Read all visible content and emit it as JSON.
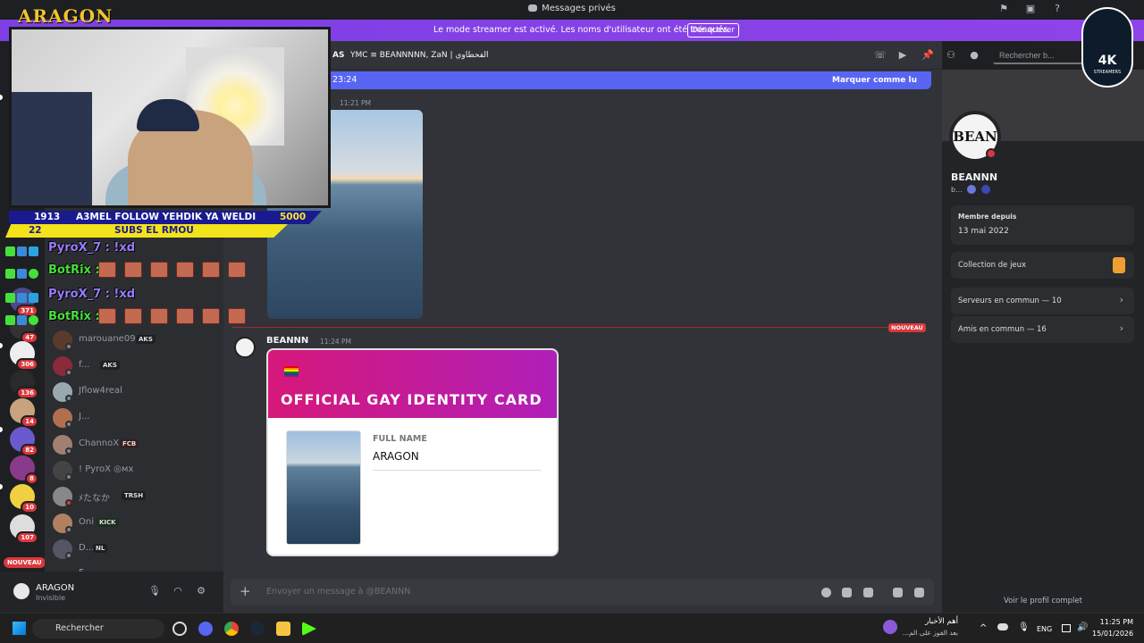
{
  "window": {
    "title": "Messages privés"
  },
  "streamer_banner": {
    "message": "Le mode streamer est activé. Les noms d'utilisateur ont été tronqués.",
    "button": "Désactiver"
  },
  "rail": {
    "badges": [
      "371",
      "47",
      "306",
      "136",
      "14",
      "82",
      "8",
      "10",
      "107"
    ],
    "nouveau": "NOUVEAU"
  },
  "dm_list": [
    {
      "name": "marouane09",
      "tag": "AKS"
    },
    {
      "name": "f...",
      "tag": "AKS"
    },
    {
      "name": "Jflow4real",
      "tag": ""
    },
    {
      "name": "J...",
      "tag": ""
    },
    {
      "name": "ChannoX",
      "tag": "FCB"
    },
    {
      "name": "! PyroX ◎мx",
      "tag": ""
    },
    {
      "name": "ﾒたなか",
      "tag": "TRSH"
    },
    {
      "name": "Oni",
      "tag": "KICK"
    },
    {
      "name": "D...",
      "tag": "NL"
    },
    {
      "name": "F",
      "tag": ""
    }
  ],
  "user_panel": {
    "name": "ARAGON",
    "status": "Invisible"
  },
  "header": {
    "group_names": "YMC ≡ BEANNNNN, ZaN | الفحطاوي",
    "prefix": "AS",
    "search_placeholder": "Rechercher b..."
  },
  "new_messages_bar": {
    "left": "23:24",
    "right": "Marquer comme lu"
  },
  "messages": {
    "photo_time": "11:21 PM",
    "new_label": "NOUVEAU",
    "author": "BEANNN",
    "author_time": "11:24 PM",
    "card": {
      "title": "OFFICIAL GAY IDENTITY CARD",
      "field_label": "FULL NAME",
      "field_value": "ARAGON"
    }
  },
  "composer": {
    "placeholder": "Envoyer un message à @BEANNN"
  },
  "profile": {
    "name": "BEANNN",
    "sub": "b...",
    "member_since_label": "Membre depuis",
    "member_since": "13 mai 2022",
    "games": "Collection de jeux",
    "servers": "Serveurs en commun — 10",
    "friends": "Amis en commun — 16",
    "full_profile": "Voir le profil complet",
    "avatar_text": "BEAN"
  },
  "overlay": {
    "logo": "ARAGON",
    "goal1_left": "1913",
    "goal1_text": "A3MEL FOLLOW YEHDIK YA WELDI",
    "goal1_right": "5000",
    "goal2_left": "22",
    "goal2_text": "SUBS EL RMOU",
    "chat": [
      {
        "user": "PyroX_7 : !xd",
        "color": "#9b7bff"
      },
      {
        "user": "BotRix :",
        "color": "#45e03b"
      },
      {
        "user": "PyroX_7 : !xd",
        "color": "#9b7bff"
      },
      {
        "user": "BotRix :",
        "color": "#45e03b"
      }
    ],
    "k4_title": "4K",
    "k4_sub": "STREAMERS"
  },
  "taskbar": {
    "search": "Rechercher",
    "news_title": "أهم الأخبار",
    "news_sub": "بعد الفوز على الم...",
    "lang": "ENG",
    "time": "11:25 PM",
    "date": "15/01/2026"
  }
}
